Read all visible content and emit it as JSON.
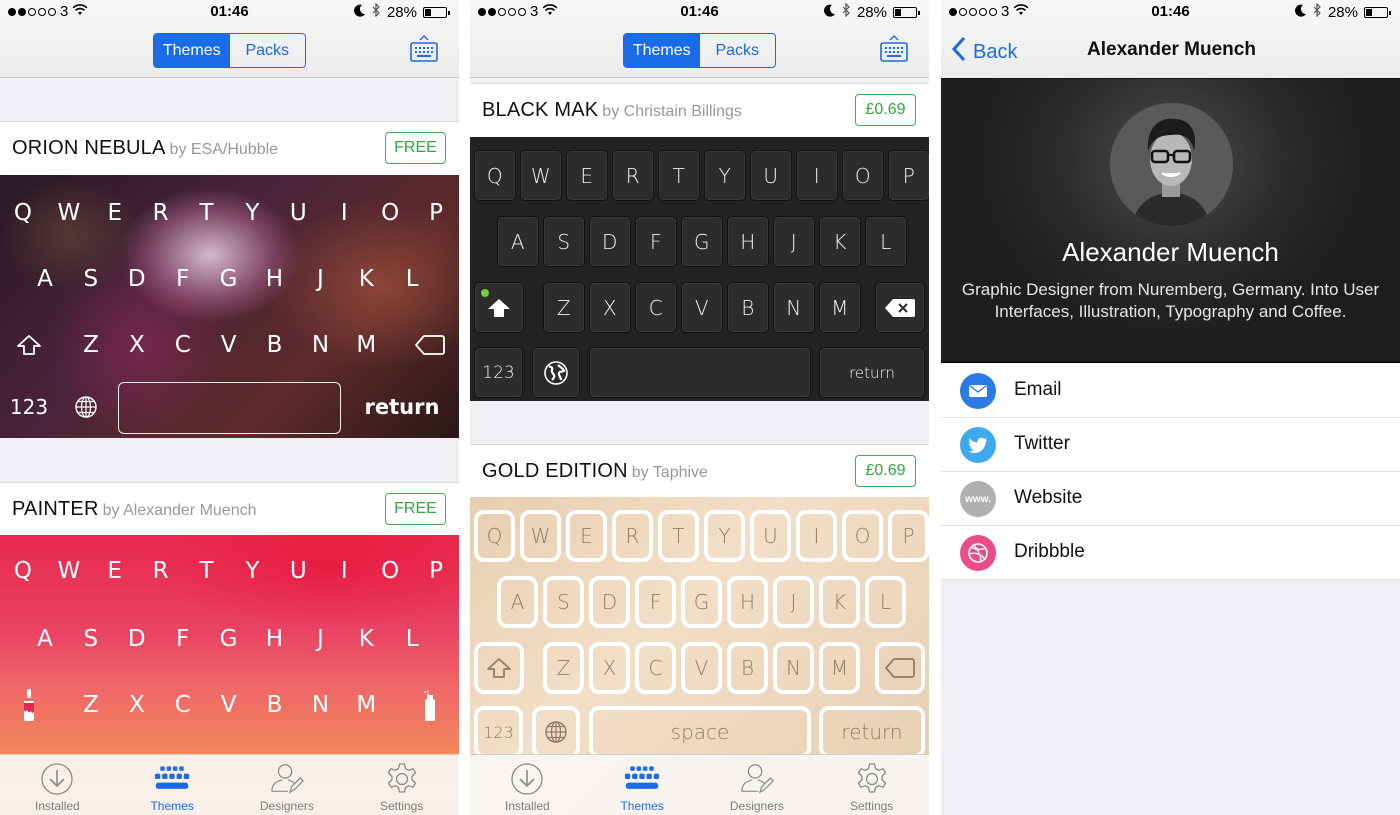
{
  "status_bar": {
    "carrier": "3",
    "time": "01:46",
    "battery": "28%",
    "battery_level": 0.28,
    "signal_phone1": 2,
    "signal_phone2": 2,
    "signal_phone3": 1
  },
  "nav": {
    "segments": [
      "Themes",
      "Packs"
    ],
    "active_segment": "Themes"
  },
  "themes": [
    {
      "name": "ORION NEBULA",
      "author": "by ESA/Hubble",
      "price": "FREE"
    },
    {
      "name": "PAINTER",
      "author": "by Alexander Muench",
      "price": "FREE"
    },
    {
      "name": "BLACK MAK",
      "author": "by Christain Billings",
      "price": "£0.69"
    },
    {
      "name": "GOLD EDITION",
      "author": "by Taphive",
      "price": "£0.69"
    }
  ],
  "keyboard": {
    "row1": [
      "Q",
      "W",
      "E",
      "R",
      "T",
      "Y",
      "U",
      "I",
      "O",
      "P"
    ],
    "row2": [
      "A",
      "S",
      "D",
      "F",
      "G",
      "H",
      "J",
      "K",
      "L"
    ],
    "row3": [
      "Z",
      "X",
      "C",
      "V",
      "B",
      "N",
      "M"
    ],
    "numbers": "123",
    "space": "space",
    "return": "return"
  },
  "tabbar": {
    "items": [
      {
        "label": "Installed",
        "icon": "download-circle-icon"
      },
      {
        "label": "Themes",
        "icon": "keyboard-icon",
        "active": true
      },
      {
        "label": "Designers",
        "icon": "person-pencil-icon"
      },
      {
        "label": "Settings",
        "icon": "gear-icon"
      }
    ]
  },
  "designer": {
    "back_label": "Back",
    "title": "Alexander Muench",
    "name": "Alexander Muench",
    "bio": "Graphic Designer from Nuremberg, Germany. Into User Interfaces, Illustration, Typography and Coffee.",
    "links": [
      {
        "label": "Email",
        "icon": "email-icon",
        "color": "#2a7be4"
      },
      {
        "label": "Twitter",
        "icon": "twitter-icon",
        "color": "#3fa9ee"
      },
      {
        "label": "Website",
        "icon": "www-icon",
        "color": "#b0b0b0",
        "glyph": "www."
      },
      {
        "label": "Dribbble",
        "icon": "dribbble-icon",
        "color": "#ea4c89"
      }
    ]
  },
  "colors": {
    "accent": "#1a6be8",
    "price_green": "#2fa83f"
  }
}
